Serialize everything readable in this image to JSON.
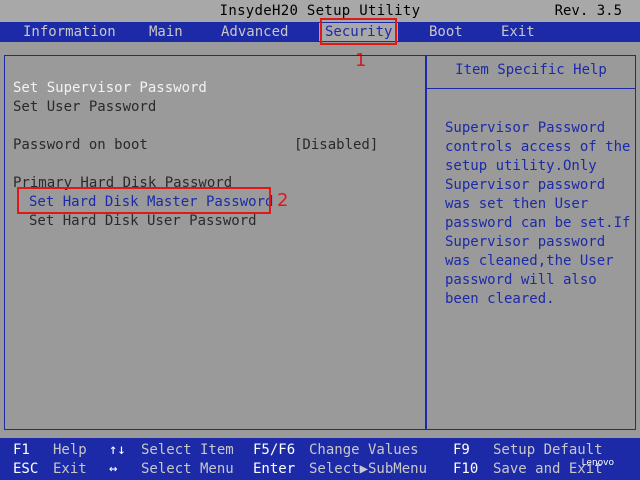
{
  "title_bar": {
    "title": "InsydeH20 Setup Utility",
    "revision": "Rev. 3.5"
  },
  "menu": {
    "items": [
      {
        "label": "Information"
      },
      {
        "label": "Main"
      },
      {
        "label": "Advanced"
      },
      {
        "label": "Security",
        "active": true
      },
      {
        "label": "Boot"
      },
      {
        "label": "Exit"
      }
    ]
  },
  "security": {
    "set_supervisor_password": "Set Supervisor Password",
    "set_user_password": "Set User Password",
    "password_on_boot_label": "Password on boot",
    "password_on_boot_value": "[Disabled]",
    "primary_hdd_heading": "Primary Hard Disk Password",
    "set_hdd_master_password": "Set Hard Disk Master Password",
    "set_hdd_user_password": "Set Hard Disk User Password"
  },
  "help": {
    "title": "Item Specific Help",
    "lines": [
      "Supervisor Password",
      "controls access of the",
      "setup utility.Only",
      "Supervisor password",
      "was set then User",
      "password can be set.If",
      "Supervisor password",
      "was cleaned,the User",
      "password will also",
      "been cleared."
    ]
  },
  "annotations": {
    "security_marker": "1",
    "master_password_marker": "2"
  },
  "footer": {
    "row1": {
      "k1": "F1",
      "d1": "Help",
      "k2": "↑↓",
      "d2": "Select Item",
      "k3": "F5/F6",
      "d3": "Change Values",
      "k4": "F9",
      "d4": "Setup Default"
    },
    "row2": {
      "k1": "ESC",
      "d1": "Exit",
      "k2": "↔",
      "d2": "Select Menu",
      "k3": "Enter",
      "d3": "Select▶SubMenu",
      "k4": "F10",
      "d4": "Save and Exit"
    },
    "logo": "Lenovo"
  },
  "colors": {
    "bios_blue": "#1c2aa8",
    "panel_gray": "#9a9a9a",
    "annotation_red": "#e01818"
  }
}
